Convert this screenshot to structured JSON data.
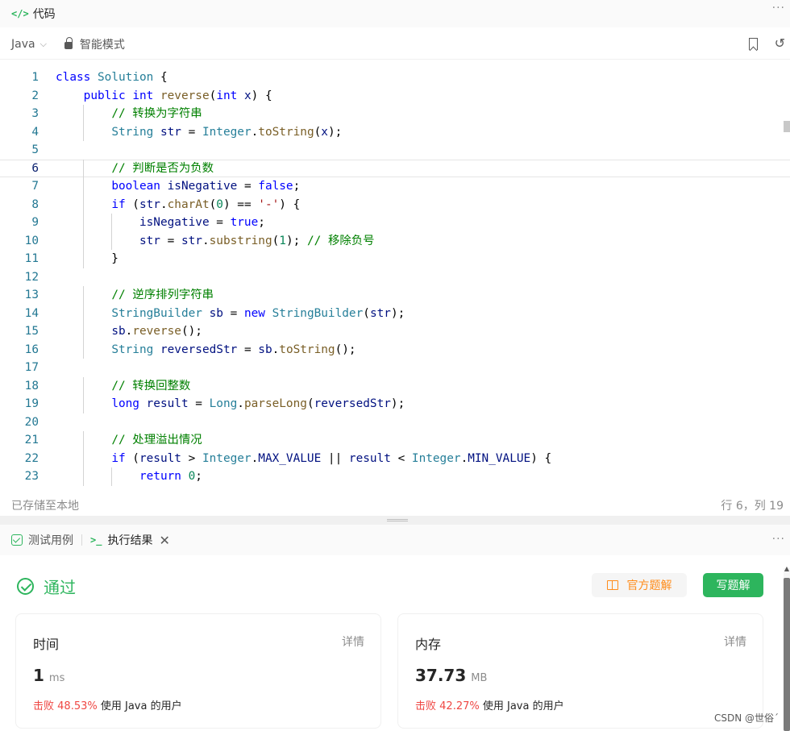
{
  "code_panel": {
    "title": "代码",
    "language": "Java",
    "mode": "智能模式",
    "more": "···",
    "reset_glyph": "↺",
    "status_saved": "已存储至本地",
    "cursor_position": "行 6，列 19"
  },
  "editor": {
    "current_line": 6,
    "lines": [
      {
        "n": "1",
        "text": "class Solution {"
      },
      {
        "n": "2",
        "text": "    public int reverse(int x) {"
      },
      {
        "n": "3",
        "text": "        // 转换为字符串"
      },
      {
        "n": "4",
        "text": "        String str = Integer.toString(x);"
      },
      {
        "n": "5",
        "text": ""
      },
      {
        "n": "6",
        "text": "        // 判断是否为负数"
      },
      {
        "n": "7",
        "text": "        boolean isNegative = false;"
      },
      {
        "n": "8",
        "text": "        if (str.charAt(0) == '-') {"
      },
      {
        "n": "9",
        "text": "            isNegative = true;"
      },
      {
        "n": "10",
        "text": "            str = str.substring(1); // 移除负号"
      },
      {
        "n": "11",
        "text": "        }"
      },
      {
        "n": "12",
        "text": ""
      },
      {
        "n": "13",
        "text": "        // 逆序排列字符串"
      },
      {
        "n": "14",
        "text": "        StringBuilder sb = new StringBuilder(str);"
      },
      {
        "n": "15",
        "text": "        sb.reverse();"
      },
      {
        "n": "16",
        "text": "        String reversedStr = sb.toString();"
      },
      {
        "n": "17",
        "text": ""
      },
      {
        "n": "18",
        "text": "        // 转换回整数"
      },
      {
        "n": "19",
        "text": "        long result = Long.parseLong(reversedStr);"
      },
      {
        "n": "20",
        "text": ""
      },
      {
        "n": "21",
        "text": "        // 处理溢出情况"
      },
      {
        "n": "22",
        "text": "        if (result > Integer.MAX_VALUE || result < Integer.MIN_VALUE) {"
      },
      {
        "n": "23",
        "text": "            return 0;"
      }
    ]
  },
  "result_panel": {
    "tab_testcase": "测试用例",
    "tab_result": "执行结果",
    "close_glyph": "✕",
    "more": "···",
    "verdict": "通过",
    "btn_official_solution": "官方题解",
    "btn_write_solution": "写题解",
    "time": {
      "label": "时间",
      "detail": "详情",
      "value": "1",
      "unit": "ms",
      "beat_prefix": "击败",
      "beat_percent": "48.53%",
      "beat_suffix": "使用 Java 的用户"
    },
    "memory": {
      "label": "内存",
      "detail": "详情",
      "value": "37.73",
      "unit": "MB",
      "beat_prefix": "击败",
      "beat_percent": "42.27%",
      "beat_suffix": "使用 Java 的用户"
    }
  },
  "watermark": "CSDN @世俗ˊ",
  "colors": {
    "accent_green": "#2db55d",
    "beat_red": "#ef4743",
    "solution_orange": "#ff8c1a"
  }
}
